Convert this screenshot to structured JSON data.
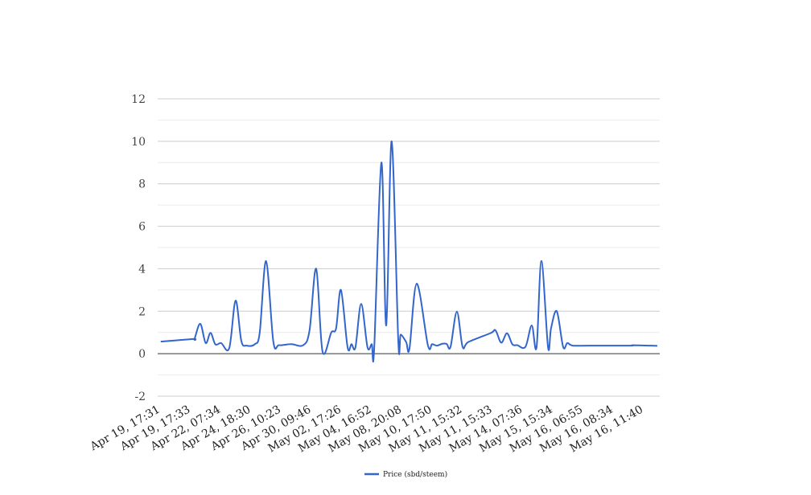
{
  "chart_data": {
    "type": "line",
    "title": "",
    "xlabel": "",
    "ylabel": "",
    "ylim": [
      -2,
      12
    ],
    "yticks": [
      -2,
      0,
      2,
      4,
      6,
      8,
      10,
      12
    ],
    "minor_gridlines": [
      -1,
      1,
      3,
      5,
      7,
      9,
      11
    ],
    "grid": true,
    "legend_position": "bottom",
    "categories": [
      "Apr 19, 17:31",
      "Apr 19, 17:33",
      "Apr 22, 07:34",
      "Apr 24, 18:30",
      "Apr 26, 10:23",
      "Apr 30, 09:46",
      "May 02, 17:26",
      "May 04, 16:52",
      "May 08, 20:08",
      "May 10, 17:50",
      "May 11, 15:32",
      "May 11, 15:33",
      "May 14, 07:36",
      "May 15, 15:34",
      "May 16, 06:55",
      "May 16, 08:34",
      "May 16, 11:40"
    ],
    "xlim": [
      -0.1,
      16.53
    ],
    "series": [
      {
        "name": "Price (sbd/steem)",
        "color": "#3366cc",
        "points": [
          [
            0,
            0.57
          ],
          [
            1.07,
            0.69
          ],
          [
            1.12,
            0.7
          ],
          [
            1.31,
            1.41
          ],
          [
            1.49,
            0.5
          ],
          [
            1.65,
            0.98
          ],
          [
            1.81,
            0.44
          ],
          [
            2.0,
            0.5
          ],
          [
            2.27,
            0.26
          ],
          [
            2.48,
            2.5
          ],
          [
            2.67,
            0.6
          ],
          [
            2.85,
            0.38
          ],
          [
            3.12,
            0.45
          ],
          [
            3.28,
            1.0
          ],
          [
            3.49,
            4.36
          ],
          [
            3.73,
            0.57
          ],
          [
            3.92,
            0.4
          ],
          [
            4.32,
            0.45
          ],
          [
            4.72,
            0.4
          ],
          [
            4.93,
            1.1
          ],
          [
            5.15,
            4.0
          ],
          [
            5.36,
            0.1
          ],
          [
            5.65,
            1.0
          ],
          [
            5.81,
            1.2
          ],
          [
            5.97,
            3.0
          ],
          [
            6.19,
            0.3
          ],
          [
            6.32,
            0.45
          ],
          [
            6.45,
            0.3
          ],
          [
            6.64,
            2.34
          ],
          [
            6.85,
            0.3
          ],
          [
            6.99,
            0.45
          ],
          [
            7.07,
            0.2
          ],
          [
            7.31,
            9.0
          ],
          [
            7.47,
            1.33
          ],
          [
            7.65,
            10.0
          ],
          [
            7.87,
            0.57
          ],
          [
            7.95,
            0.9
          ],
          [
            8.13,
            0.55
          ],
          [
            8.24,
            0.24
          ],
          [
            8.48,
            3.3
          ],
          [
            8.85,
            0.4
          ],
          [
            8.99,
            0.45
          ],
          [
            9.15,
            0.38
          ],
          [
            9.33,
            0.47
          ],
          [
            9.47,
            0.46
          ],
          [
            9.6,
            0.32
          ],
          [
            9.81,
            1.98
          ],
          [
            10.0,
            0.32
          ],
          [
            10.19,
            0.55
          ],
          [
            10.93,
            0.97
          ],
          [
            11.09,
            1.1
          ],
          [
            11.28,
            0.52
          ],
          [
            11.47,
            0.96
          ],
          [
            11.65,
            0.44
          ],
          [
            11.81,
            0.4
          ],
          [
            12.08,
            0.32
          ],
          [
            12.29,
            1.33
          ],
          [
            12.45,
            0.3
          ],
          [
            12.61,
            4.36
          ],
          [
            12.83,
            0.3
          ],
          [
            12.93,
            1.2
          ],
          [
            13.12,
            2.0
          ],
          [
            13.33,
            0.32
          ],
          [
            13.47,
            0.5
          ],
          [
            13.65,
            0.38
          ],
          [
            14.21,
            0.38
          ],
          [
            15.55,
            0.38
          ],
          [
            15.65,
            0.4
          ],
          [
            16.45,
            0.37
          ]
        ]
      }
    ]
  }
}
